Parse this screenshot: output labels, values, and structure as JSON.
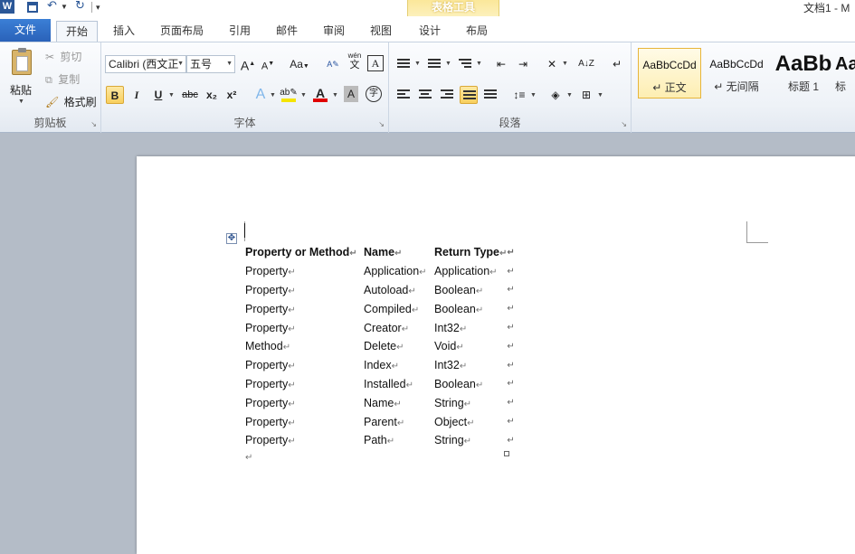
{
  "app": {
    "doc_title": "文档1 - M",
    "logo_letter": "W",
    "context_group_title": "表格工具"
  },
  "tabs": {
    "file": "文件",
    "home": "开始",
    "insert": "插入",
    "page_layout": "页面布局",
    "references": "引用",
    "mailings": "邮件",
    "review": "审阅",
    "view": "视图",
    "design": "设计",
    "layout": "布局"
  },
  "clipboard": {
    "paste": "粘贴",
    "cut": "剪切",
    "copy": "复制",
    "format_painter": "格式刷",
    "group_label": "剪贴板"
  },
  "font": {
    "font_name": "Calibri (西文正",
    "font_size": "五号",
    "grow": "A",
    "shrink": "A",
    "change_case": "Aa",
    "bold": "B",
    "italic": "I",
    "underline": "U",
    "strike": "abc",
    "subscript": "x₂",
    "superscript": "x²",
    "text_effects": "A",
    "font_color": "A",
    "char_shading": "A",
    "enclose": "字",
    "phonetic_top": "wén",
    "phonetic_bottom": "文",
    "group_label": "字体",
    "highlight_color": "#f5e400",
    "font_color_value": "#e00000"
  },
  "paragraph": {
    "group_label": "段落"
  },
  "styles": [
    {
      "preview": "AaBbCcDd",
      "name": "↵ 正文"
    },
    {
      "preview": "AaBbCcDd",
      "name": "↵ 无间隔"
    },
    {
      "preview": "AaBb",
      "name": "标题 1"
    },
    {
      "preview": "Aa",
      "name": "标"
    }
  ],
  "table": {
    "headers": [
      "Property or Method",
      "Name",
      "Return Type"
    ],
    "rows": [
      [
        "Property",
        "Application",
        "Application"
      ],
      [
        "Property",
        "Autoload",
        "Boolean"
      ],
      [
        "Property",
        "Compiled",
        "Boolean"
      ],
      [
        "Property",
        "Creator",
        "Int32"
      ],
      [
        "Method",
        "Delete",
        "Void"
      ],
      [
        "Property",
        "Index",
        "Int32"
      ],
      [
        "Property",
        "Installed",
        "Boolean"
      ],
      [
        "Property",
        "Name",
        "String"
      ],
      [
        "Property",
        "Parent",
        "Object"
      ],
      [
        "Property",
        "Path",
        "String"
      ]
    ]
  },
  "marks": {
    "cell_end": "↵",
    "paragraph": "↵",
    "table_move": "✥"
  }
}
